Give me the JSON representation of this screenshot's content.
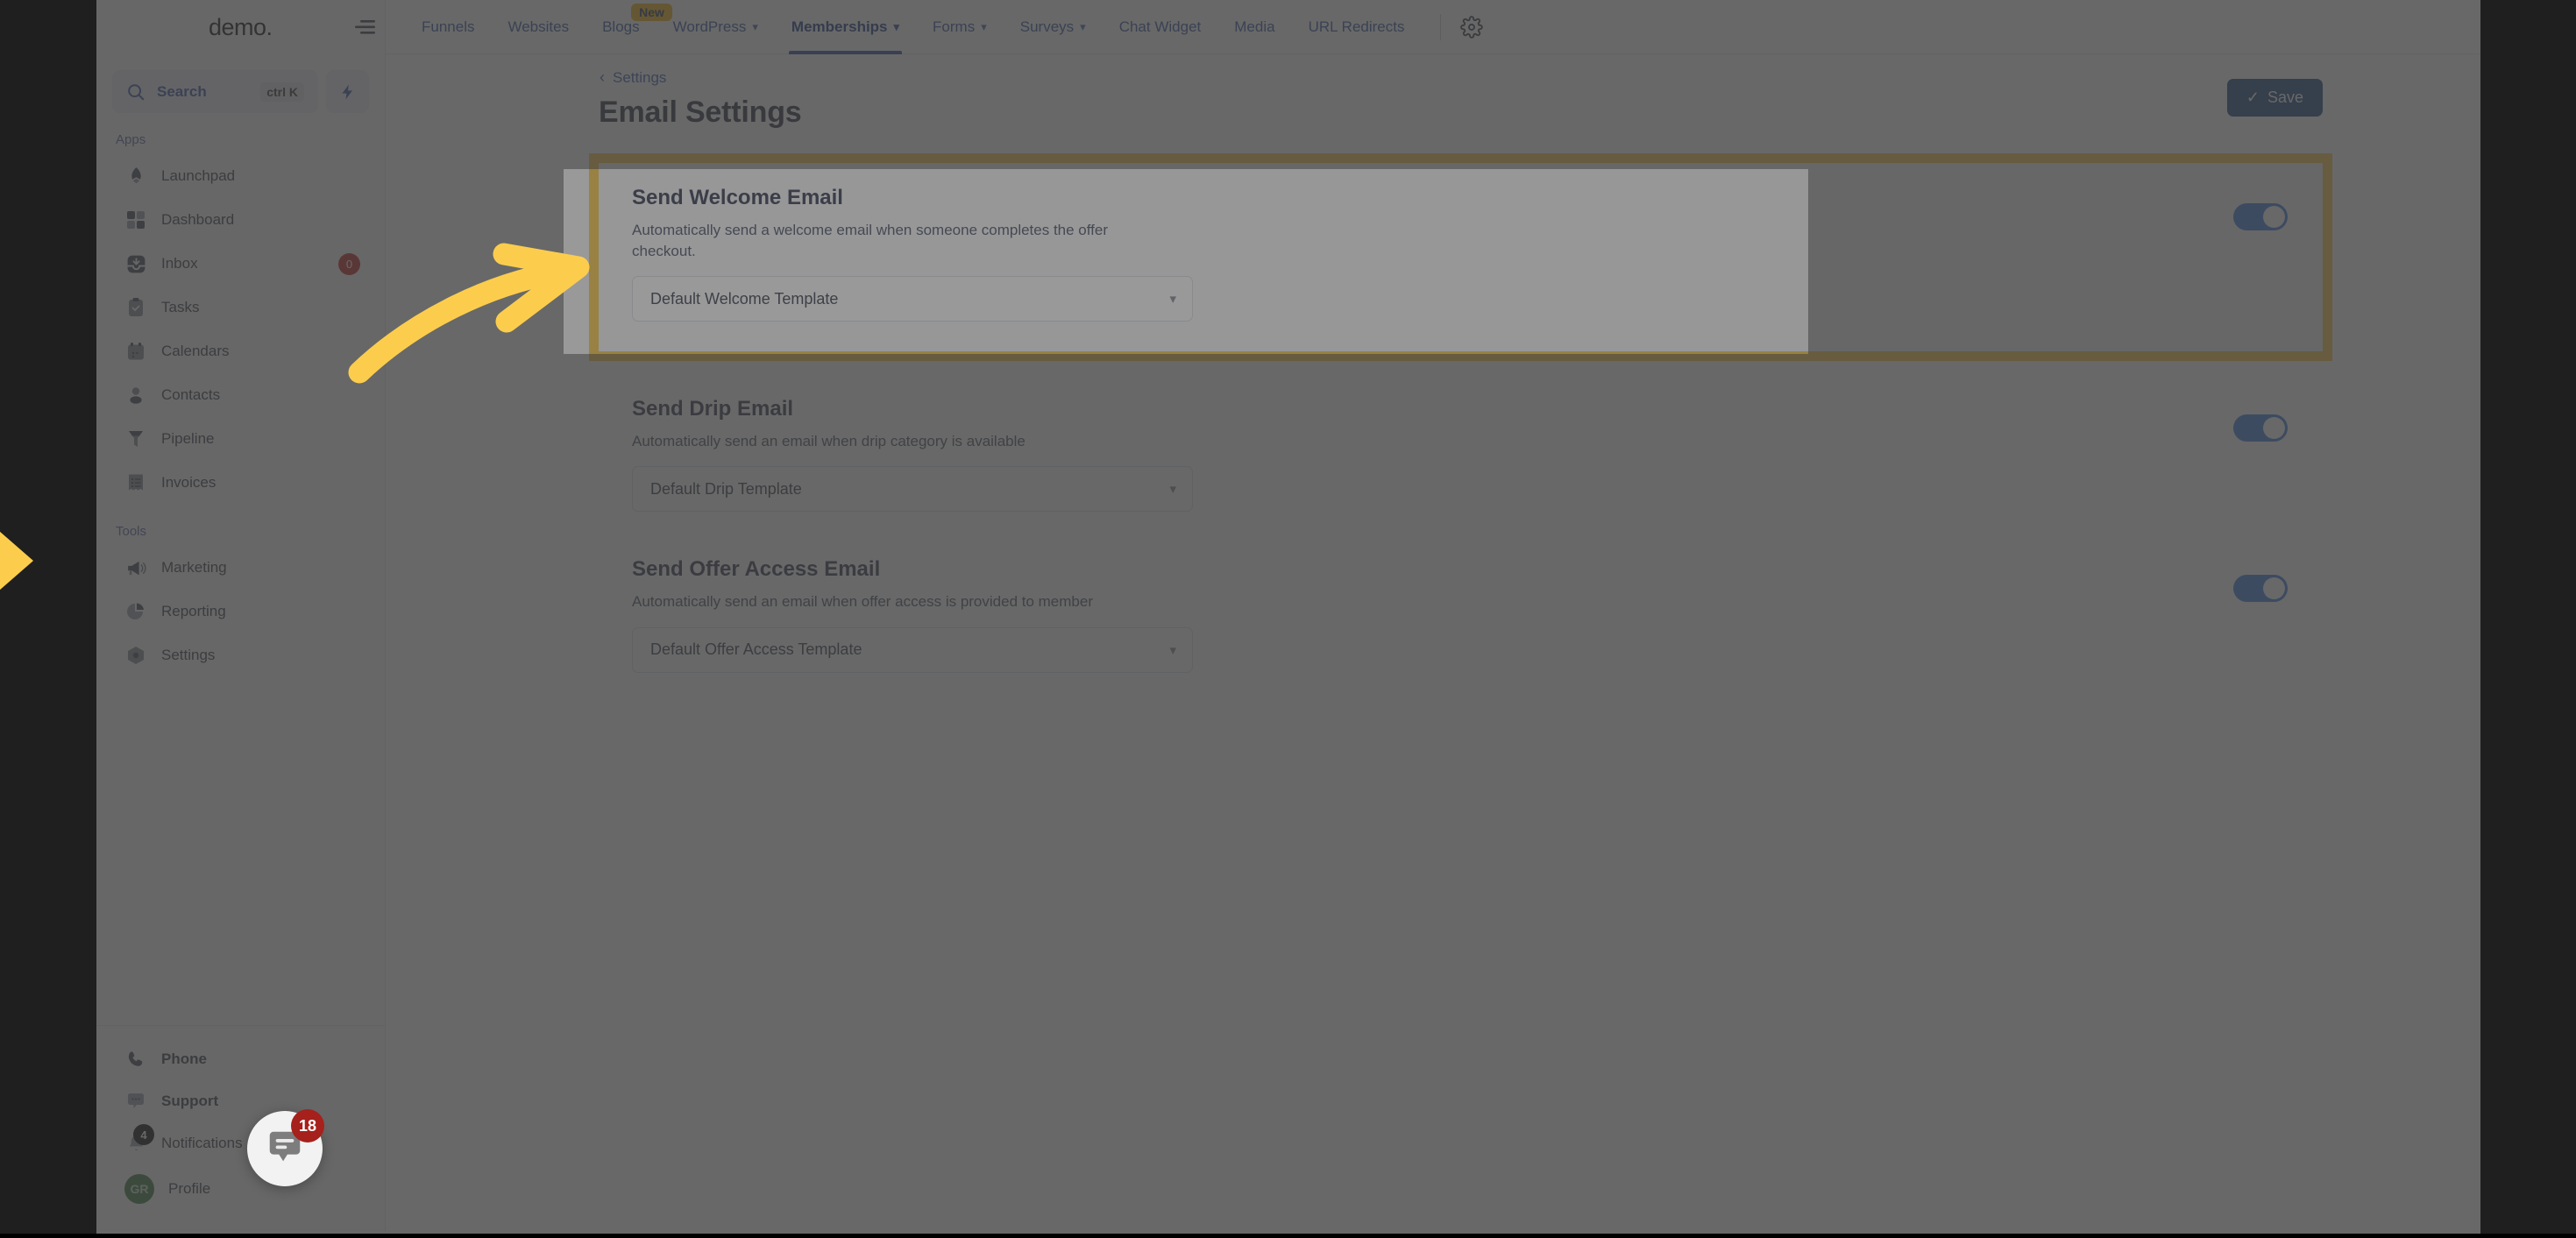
{
  "brand": {
    "name": "demo",
    "dot": "."
  },
  "search": {
    "label": "Search",
    "shortcut": "ctrl K"
  },
  "sidebar": {
    "sections": [
      {
        "title": "Apps",
        "items": [
          {
            "label": "Launchpad",
            "icon": "rocket-icon",
            "badge": null
          },
          {
            "label": "Dashboard",
            "icon": "grid-icon",
            "badge": null
          },
          {
            "label": "Inbox",
            "icon": "inbox-icon",
            "badge": "0"
          },
          {
            "label": "Tasks",
            "icon": "clipboard-check-icon",
            "badge": null
          },
          {
            "label": "Calendars",
            "icon": "calendar-icon",
            "badge": null
          },
          {
            "label": "Contacts",
            "icon": "user-icon",
            "badge": null
          },
          {
            "label": "Pipeline",
            "icon": "funnel-icon",
            "badge": null
          },
          {
            "label": "Invoices",
            "icon": "invoice-icon",
            "badge": null
          }
        ]
      },
      {
        "title": "Tools",
        "items": [
          {
            "label": "Marketing",
            "icon": "megaphone-icon",
            "badge": null
          },
          {
            "label": "Reporting",
            "icon": "pie-chart-icon",
            "badge": null
          },
          {
            "label": "Settings",
            "icon": "gear-hex-icon",
            "badge": null
          }
        ]
      }
    ],
    "bottom": [
      {
        "label": "Phone",
        "icon": "phone-icon",
        "badge": null,
        "avatar": null
      },
      {
        "label": "Support",
        "icon": "chat-dots-icon",
        "badge": null,
        "avatar": null
      },
      {
        "label": "Notifications",
        "icon": "bell-icon",
        "badge": "4",
        "avatar": null
      },
      {
        "label": "Profile",
        "icon": "avatar-icon",
        "badge": null,
        "avatar": "GR"
      }
    ],
    "chat_fab": {
      "badge": "18",
      "icon": "chat-bubble-icon"
    }
  },
  "topnav": {
    "tabs": [
      {
        "label": "Funnels",
        "caret": false,
        "active": false,
        "badge": null
      },
      {
        "label": "Websites",
        "caret": false,
        "active": false,
        "badge": null
      },
      {
        "label": "Blogs",
        "caret": false,
        "active": false,
        "badge": "New"
      },
      {
        "label": "WordPress",
        "caret": true,
        "active": false,
        "badge": null
      },
      {
        "label": "Memberships",
        "caret": true,
        "active": true,
        "badge": null
      },
      {
        "label": "Forms",
        "caret": true,
        "active": false,
        "badge": null
      },
      {
        "label": "Surveys",
        "caret": true,
        "active": false,
        "badge": null
      },
      {
        "label": "Chat Widget",
        "caret": false,
        "active": false,
        "badge": null
      },
      {
        "label": "Media",
        "caret": false,
        "active": false,
        "badge": null
      },
      {
        "label": "URL Redirects",
        "caret": false,
        "active": false,
        "badge": null
      }
    ],
    "settings_icon": "gear-icon",
    "collapse_icon": "collapse-menu-icon"
  },
  "main": {
    "breadcrumb": {
      "chevron": "‹",
      "label": "Settings"
    },
    "page_title": "Email Settings",
    "save_button": {
      "label": "Save",
      "icon": "check-icon"
    },
    "cards": [
      {
        "title": "Send Welcome Email",
        "description": "Automatically send a welcome email when someone completes the offer checkout.",
        "select_value": "Default Welcome Template",
        "toggle_on": true,
        "highlighted": true
      },
      {
        "title": "Send Drip Email",
        "description": "Automatically send an email when drip category is available",
        "select_value": "Default Drip Template",
        "toggle_on": true,
        "highlighted": false
      },
      {
        "title": "Send Offer Access Email",
        "description": "Automatically send an email when offer access is provided to member",
        "select_value": "Default Offer Access Template",
        "toggle_on": true,
        "highlighted": false
      }
    ]
  },
  "colors": {
    "accent_blue": "#3659a5",
    "highlight_yellow": "#fccd4d",
    "arrow_yellow": "#fccd4d",
    "save_button_bg": "#244b85",
    "toggle_on": "#4482e0",
    "badge_red": "#c32b2b",
    "avatar_green": "#3f7d45"
  }
}
